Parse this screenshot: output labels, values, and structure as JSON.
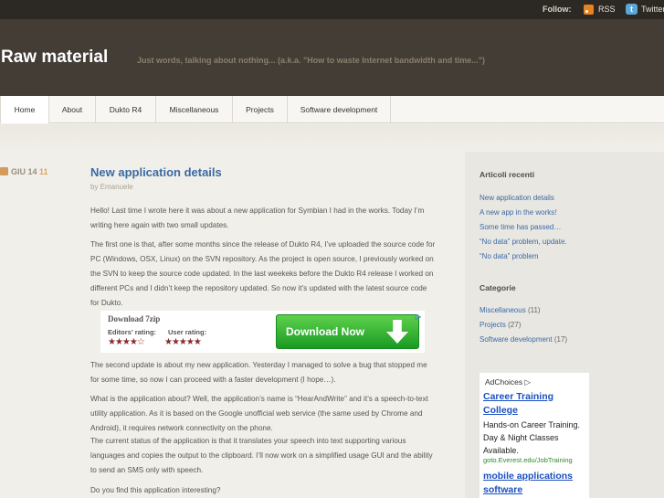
{
  "topbar": {
    "follow_label": "Follow:",
    "rss_label": "RSS",
    "twitter_label": "Twitter",
    "twitter_icon_glyph": "t"
  },
  "header": {
    "site_title": "Raw material",
    "tagline": "Just words, talking about nothing... (a.k.a. \"How to waste Internet bandwidth and time...\")"
  },
  "nav": {
    "items": [
      {
        "label": "Home"
      },
      {
        "label": "About"
      },
      {
        "label": "Dukto R4"
      },
      {
        "label": "Miscellaneous"
      },
      {
        "label": "Projects"
      },
      {
        "label": "Software development"
      }
    ]
  },
  "post": {
    "date": "GIU 14",
    "comments_count": "11",
    "title": "New application details",
    "byline": "by Emanuele",
    "paragraphs": [
      "Hello! Last time I wrote here it was about a new application for Symbian I had in the works. Today I’m writing here again with two small updates.",
      "The first one is that, after some months since the release of Dukto R4, I’ve uploaded the source code for PC (Windows, OSX, Linux) on the SVN repository. As the project is open source, I previously worked on the SVN to keep the source code updated. In the last weekeks before the Dukto R4 release I worked on different PCs and I didn’t keep the repository updated. So now it’s updated with the latest source code for Dukto.",
      "The second update is about my new application. Yesterday I managed to solve a bug that stopped me for some time, so now I can proceed with a faster development (I hope…).",
      "What is the application about? Well, the application’s name is “HearAndWrite” and it’s a speech-to-text utility application. As it is based on the Google unofficial web service (the same used by Chrome and Android), it requires network connectivity on the phone.",
      "The current status of the application is that it translates your speech into text supporting various languages and copies the output to the clipboard. I’ll now work on a simplified usage GUI and the ability to send an SMS only with speech.",
      "Do you find this application interesting?"
    ]
  },
  "download_ad": {
    "title": "Download 7zip",
    "editors_rating_label": "Editors' rating:",
    "user_rating_label": "User rating:",
    "editors_stars": "★★★★☆",
    "user_stars": "★★★★★",
    "editors_rating": 4,
    "user_rating": 5,
    "button_label": "Download Now",
    "corner_mark": "▷"
  },
  "sidebar": {
    "recent_title": "Articoli recenti",
    "recent_posts": [
      "New application details",
      "A new app in the works!",
      "Some time has passed…",
      "“No data” problem, update.",
      "“No data” problem"
    ],
    "categories_title": "Categorie",
    "categories": [
      {
        "name": "Miscellaneous",
        "count": "(11)"
      },
      {
        "name": "Projects",
        "count": "(27)"
      },
      {
        "name": "Software development",
        "count": "(17)"
      }
    ]
  },
  "adchoices": {
    "label": "AdChoices ▷",
    "ad1_title": "Career Training College",
    "ad1_text": "Hands-on Career Training. Day & Night Classes Available.",
    "ad1_url": "goto.Everest.edu/JobTraining",
    "ad2_title": "mobile applications software"
  },
  "colors": {
    "header_bg": "#433d36",
    "topbar_bg": "#2c2823",
    "link": "#3b6aa5",
    "download_green": "#2fb133"
  }
}
